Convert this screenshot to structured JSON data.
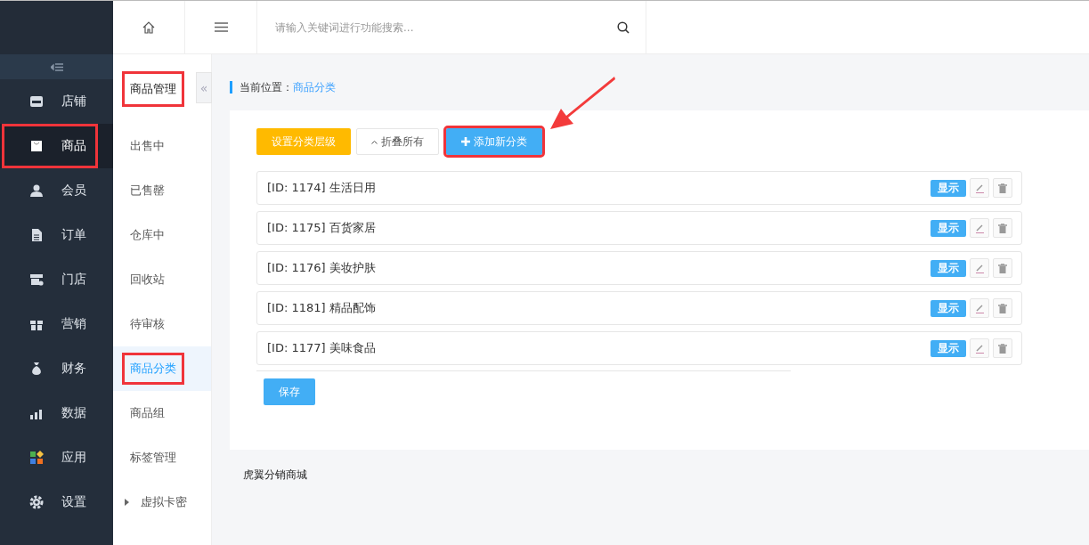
{
  "nav": [
    {
      "label": "店铺",
      "selected": false,
      "highlighted": false
    },
    {
      "label": "商品",
      "selected": true,
      "highlighted": true
    },
    {
      "label": "会员",
      "selected": false,
      "highlighted": false
    },
    {
      "label": "订单",
      "selected": false,
      "highlighted": false
    },
    {
      "label": "门店",
      "selected": false,
      "highlighted": false
    },
    {
      "label": "营销",
      "selected": false,
      "highlighted": false
    },
    {
      "label": "财务",
      "selected": false,
      "highlighted": false
    },
    {
      "label": "数据",
      "selected": false,
      "highlighted": false
    },
    {
      "label": "应用",
      "selected": false,
      "highlighted": false
    },
    {
      "label": "设置",
      "selected": false,
      "highlighted": false
    }
  ],
  "subnav": {
    "title": "商品管理",
    "title_highlighted": true,
    "collapse_glyph": "«",
    "items": [
      {
        "label": "出售中",
        "selected": false,
        "highlighted": false,
        "expandable": false
      },
      {
        "label": "已售罄",
        "selected": false,
        "highlighted": false,
        "expandable": false
      },
      {
        "label": "仓库中",
        "selected": false,
        "highlighted": false,
        "expandable": false
      },
      {
        "label": "回收站",
        "selected": false,
        "highlighted": false,
        "expandable": false
      },
      {
        "label": "待审核",
        "selected": false,
        "highlighted": false,
        "expandable": false
      },
      {
        "label": "商品分类",
        "selected": true,
        "highlighted": true,
        "expandable": false
      },
      {
        "label": "商品组",
        "selected": false,
        "highlighted": false,
        "expandable": false
      },
      {
        "label": "标签管理",
        "selected": false,
        "highlighted": false,
        "expandable": false
      },
      {
        "label": "虚拟卡密",
        "selected": false,
        "highlighted": false,
        "expandable": true
      }
    ]
  },
  "search": {
    "placeholder": "请输入关键词进行功能搜索..."
  },
  "breadcrumb": {
    "label": "当前位置：",
    "current": "商品分类"
  },
  "toolbar": [
    {
      "label": "设置分类层级",
      "kind": "warning",
      "highlighted": false
    },
    {
      "label": "折叠所有",
      "kind": "plain",
      "highlighted": false
    },
    {
      "label": "添加新分类",
      "kind": "primary",
      "highlighted": true
    }
  ],
  "categories": [
    {
      "name": "[ID: 1174] 生活日用",
      "status": "显示"
    },
    {
      "name": "[ID: 1175] 百货家居",
      "status": "显示"
    },
    {
      "name": "[ID: 1176] 美妆护肤",
      "status": "显示"
    },
    {
      "name": "[ID: 1181] 精品配饰",
      "status": "显示"
    },
    {
      "name": "[ID: 1177] 美味食品",
      "status": "显示"
    }
  ],
  "save_button": "保存",
  "footer": "虎翼分销商城"
}
